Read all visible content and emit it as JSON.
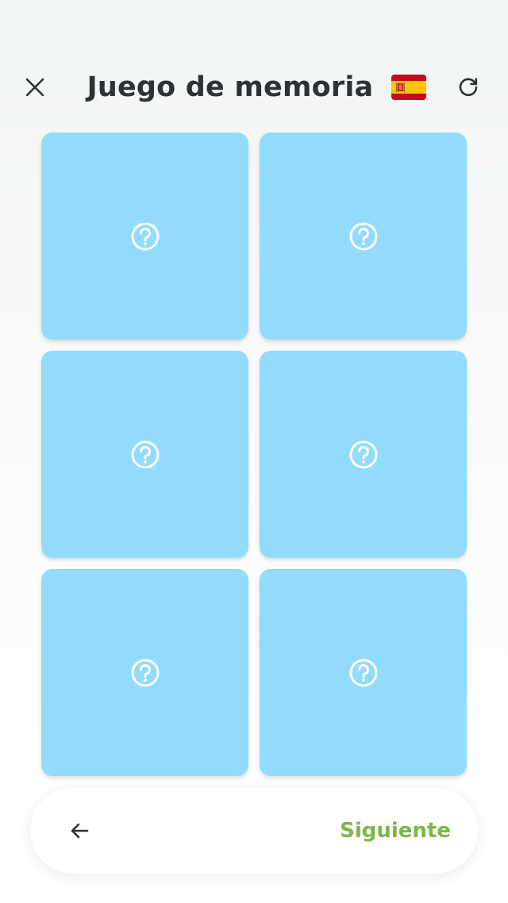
{
  "header": {
    "title": "Juego de memoria",
    "language_flag": "spain-flag-icon",
    "close_icon": "close-icon",
    "refresh_icon": "refresh-icon"
  },
  "cards": [
    {
      "state": "face-down",
      "icon": "question-circle-icon"
    },
    {
      "state": "face-down",
      "icon": "question-circle-icon"
    },
    {
      "state": "face-down",
      "icon": "question-circle-icon"
    },
    {
      "state": "face-down",
      "icon": "question-circle-icon"
    },
    {
      "state": "face-down",
      "icon": "question-circle-icon"
    },
    {
      "state": "face-down",
      "icon": "question-circle-icon"
    }
  ],
  "footer": {
    "back_icon": "arrow-left-icon",
    "next_label": "Siguiente"
  },
  "colors": {
    "card": "#92dbfd",
    "title": "#2e3135",
    "next": "#7ab648",
    "background_top": "#f1f5f3",
    "background_bottom": "#ffffff"
  }
}
